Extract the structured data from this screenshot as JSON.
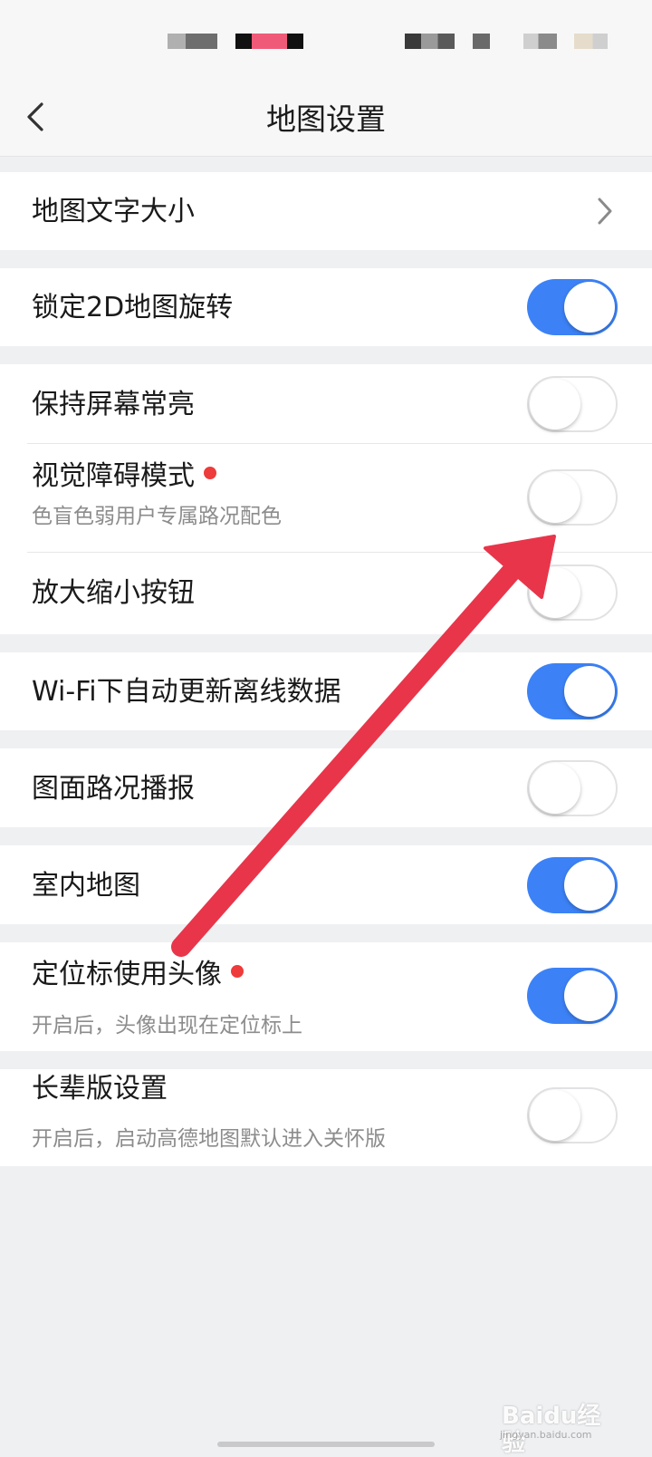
{
  "nav": {
    "title": "地图设置",
    "back_icon": "chevron-left-icon"
  },
  "sections": [
    {
      "rows": [
        {
          "title": "地图文字大小",
          "control": "chevron",
          "icon": "chevron-right-icon"
        }
      ]
    },
    {
      "rows": [
        {
          "title": "锁定2D地图旋转",
          "control": "toggle",
          "on": true
        }
      ]
    },
    {
      "rows": [
        {
          "title": "保持屏幕常亮",
          "control": "toggle",
          "on": false
        },
        {
          "title": "视觉障碍模式",
          "subtitle": "色盲色弱用户专属路况配色",
          "control": "toggle",
          "on": false,
          "new_dot": true
        },
        {
          "title": "放大缩小按钮",
          "control": "toggle",
          "on": false
        }
      ]
    },
    {
      "rows": [
        {
          "title": "Wi-Fi下自动更新离线数据",
          "control": "toggle",
          "on": true
        }
      ]
    },
    {
      "rows": [
        {
          "title": "图面路况播报",
          "control": "toggle",
          "on": false
        }
      ]
    },
    {
      "rows": [
        {
          "title": "室内地图",
          "control": "toggle",
          "on": true
        }
      ]
    },
    {
      "rows": [
        {
          "title": "定位标使用头像",
          "subtitle": "开启后，头像出现在定位标上",
          "control": "toggle",
          "on": true,
          "new_dot": true
        }
      ]
    },
    {
      "rows": [
        {
          "title": "长辈版设置",
          "subtitle": "开启后，启动高德地图默认进入关怀版",
          "control": "toggle",
          "on": false
        }
      ]
    }
  ],
  "annotation": {
    "icon": "annotation-arrow-icon",
    "color": "#e8354a"
  },
  "watermark": {
    "brand": "Baidu经验",
    "domain": "jingyan.baidu.com"
  },
  "colors": {
    "toggle_on": "#3c82f6",
    "background": "#eff0f2",
    "red_dot": "#ee3b3b"
  }
}
